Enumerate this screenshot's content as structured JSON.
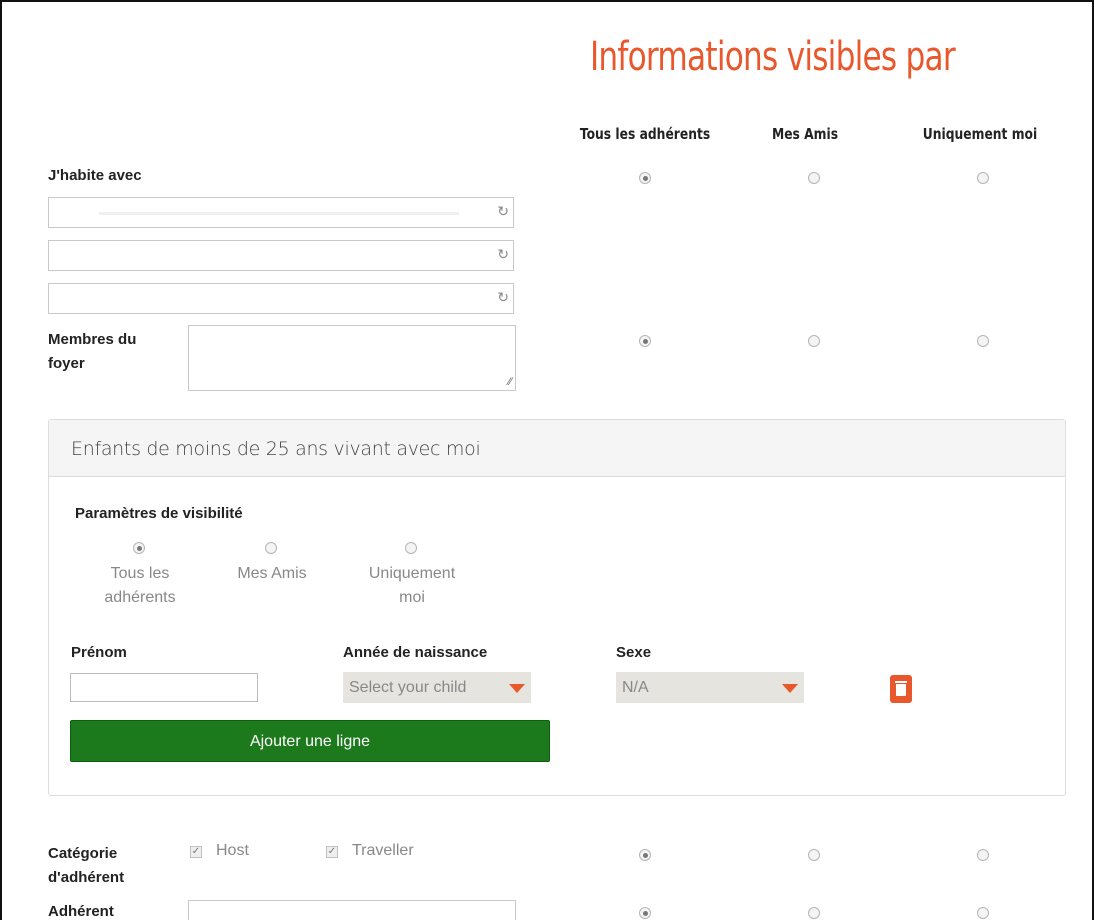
{
  "heading": "Informations visibles par",
  "columns": [
    "Tous les adhérents",
    "Mes Amis",
    "Uniquement moi"
  ],
  "habite": {
    "label": "J'habite avec",
    "selected": 0,
    "inputs": [
      "",
      "",
      ""
    ]
  },
  "foyer": {
    "label_line1": "Membres du",
    "label_line2": "foyer",
    "value": "",
    "selected": 0
  },
  "enfants": {
    "title": "Enfants de moins de 25 ans vivant avec moi",
    "visibility_label": "Paramètres de visibilité",
    "visibility_options": [
      {
        "line1": "Tous les",
        "line2": "adhérents"
      },
      {
        "line1": "Mes Amis",
        "line2": ""
      },
      {
        "line1": "Uniquement",
        "line2": "moi"
      }
    ],
    "visibility_selected": 0,
    "col_prenom": "Prénom",
    "col_annee": "Année de naissance",
    "col_sexe": "Sexe",
    "prenom_value": "",
    "annee_value": "Select your child",
    "sexe_value": "N/A",
    "add_button": "Ajouter une ligne"
  },
  "categorie": {
    "label_line1": "Catégorie",
    "label_line2": "d'adhérent",
    "options": [
      "Host",
      "Traveller"
    ],
    "checked": [
      true,
      true
    ],
    "selected": 0
  },
  "adherent": {
    "label": "Adhérent",
    "value": "",
    "selected": 0
  },
  "colors": {
    "accent": "#e8582c",
    "button": "#1c7a1c"
  }
}
